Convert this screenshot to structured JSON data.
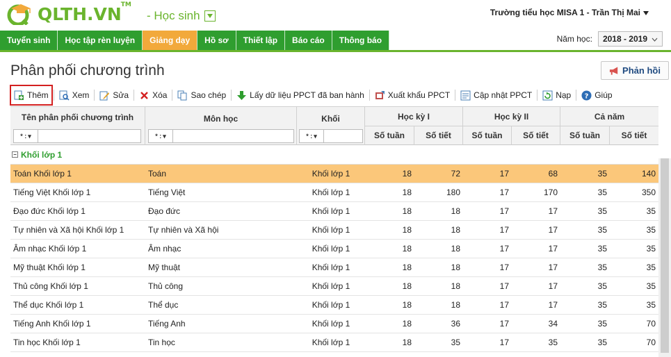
{
  "header": {
    "logo_text": "QLTH.VN",
    "logo_tm": "TM",
    "role_label": "- Học sinh",
    "user_label": "Trường tiểu học MISA 1 - Trần Thị Mai"
  },
  "nav": {
    "items": [
      "Tuyển sinh",
      "Học tập rèn luyện",
      "Giảng dạy",
      "Hồ sơ",
      "Thiết lập",
      "Báo cáo",
      "Thông báo"
    ],
    "active": "Giảng dạy",
    "year_label": "Năm học:",
    "year_value": "2018 - 2019"
  },
  "page": {
    "title": "Phân phối chương trình",
    "feedback_label": "Phản hồi"
  },
  "toolbar": {
    "add": "Thêm",
    "view": "Xem",
    "edit": "Sửa",
    "delete": "Xóa",
    "copy": "Sao chép",
    "fetch": "Lấy dữ liệu PPCT đã ban hành",
    "export": "Xuất khẩu PPCT",
    "update": "Cập nhật PPCT",
    "reload": "Nạp",
    "help": "Giúp"
  },
  "grid": {
    "headers": {
      "name": "Tên phân phối chương trình",
      "subject": "Môn học",
      "grade": "Khối",
      "term1": "Học kỳ I",
      "term2": "Học kỳ II",
      "year": "Cả năm",
      "weeks": "Số tuần",
      "periods": "Số tiết"
    },
    "filter_op": "* :",
    "group_label": "Khối lớp 1",
    "rows": [
      {
        "name": "Toán Khối lớp 1",
        "subject": "Toán",
        "grade": "Khối lớp 1",
        "w1": "18",
        "p1": "72",
        "w2": "17",
        "p2": "68",
        "wy": "35",
        "py": "140"
      },
      {
        "name": "Tiếng Việt Khối lớp 1",
        "subject": "Tiếng Việt",
        "grade": "Khối lớp 1",
        "w1": "18",
        "p1": "180",
        "w2": "17",
        "p2": "170",
        "wy": "35",
        "py": "350"
      },
      {
        "name": "Đạo đức Khối lớp 1",
        "subject": "Đạo đức",
        "grade": "Khối lớp 1",
        "w1": "18",
        "p1": "18",
        "w2": "17",
        "p2": "17",
        "wy": "35",
        "py": "35"
      },
      {
        "name": "Tự nhiên và Xã hội Khối lớp 1",
        "subject": "Tự nhiên và Xã hội",
        "grade": "Khối lớp 1",
        "w1": "18",
        "p1": "18",
        "w2": "17",
        "p2": "17",
        "wy": "35",
        "py": "35"
      },
      {
        "name": "Âm nhạc Khối lớp 1",
        "subject": "Âm nhạc",
        "grade": "Khối lớp 1",
        "w1": "18",
        "p1": "18",
        "w2": "17",
        "p2": "17",
        "wy": "35",
        "py": "35"
      },
      {
        "name": "Mỹ thuật Khối lớp 1",
        "subject": "Mỹ thuật",
        "grade": "Khối lớp 1",
        "w1": "18",
        "p1": "18",
        "w2": "17",
        "p2": "17",
        "wy": "35",
        "py": "35"
      },
      {
        "name": "Thủ công Khối lớp 1",
        "subject": "Thủ công",
        "grade": "Khối lớp 1",
        "w1": "18",
        "p1": "18",
        "w2": "17",
        "p2": "17",
        "wy": "35",
        "py": "35"
      },
      {
        "name": "Thể dục Khối lớp 1",
        "subject": "Thể dục",
        "grade": "Khối lớp 1",
        "w1": "18",
        "p1": "18",
        "w2": "17",
        "p2": "17",
        "wy": "35",
        "py": "35"
      },
      {
        "name": "Tiếng Anh Khối lớp 1",
        "subject": "Tiếng Anh",
        "grade": "Khối lớp 1",
        "w1": "18",
        "p1": "36",
        "w2": "17",
        "p2": "34",
        "wy": "35",
        "py": "70"
      },
      {
        "name": "Tin học Khối lớp 1",
        "subject": "Tin học",
        "grade": "Khối lớp 1",
        "w1": "18",
        "p1": "35",
        "w2": "17",
        "p2": "35",
        "wy": "35",
        "py": "70"
      }
    ]
  },
  "colors": {
    "brand_green": "#6ab42d",
    "nav_green": "#2f9e2f",
    "nav_active": "#f2a93b",
    "row_selected": "#fbc77a"
  },
  "icons": {
    "logo": "graduation-cap-icon",
    "feedback": "megaphone-icon",
    "add": "add-document-icon",
    "view": "view-document-icon",
    "edit": "edit-pencil-icon",
    "delete": "red-x-icon",
    "copy": "copy-icon",
    "fetch": "green-down-arrow-icon",
    "export": "export-icon",
    "update": "update-icon",
    "reload": "reload-icon",
    "help": "help-question-icon"
  }
}
